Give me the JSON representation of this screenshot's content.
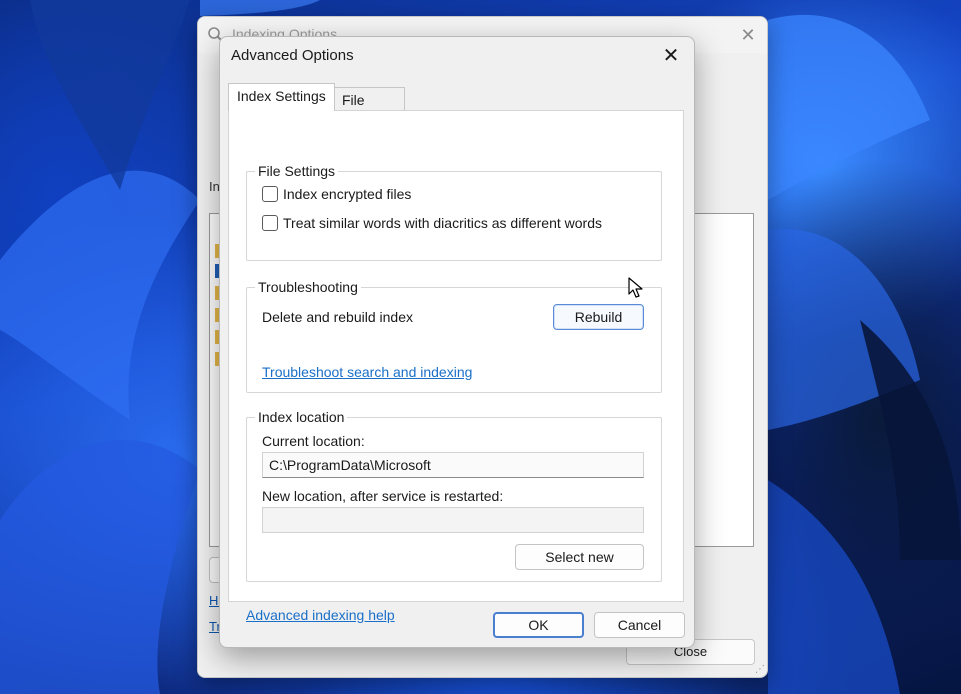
{
  "background_window": {
    "title": "Indexing Options",
    "label_fragment": "In",
    "link1_fragment": "Ho",
    "link2_fragment": "Tr",
    "close_button": "Close",
    "close_icon": "close-icon"
  },
  "dialog": {
    "title": "Advanced Options",
    "close_icon": "close-icon",
    "tabs": [
      {
        "label": "Index Settings",
        "active": true
      },
      {
        "label": "File Types",
        "active": false
      }
    ],
    "file_settings": {
      "title": "File Settings",
      "checkboxes": [
        {
          "label": "Index encrypted files",
          "checked": false
        },
        {
          "label": "Treat similar words with diacritics as different words",
          "checked": false
        }
      ]
    },
    "troubleshooting": {
      "title": "Troubleshooting",
      "description": "Delete and rebuild index",
      "rebuild_button": "Rebuild",
      "link": "Troubleshoot search and indexing"
    },
    "index_location": {
      "title": "Index location",
      "current_label": "Current location:",
      "current_value": "C:\\ProgramData\\Microsoft",
      "new_label": "New location, after service is restarted:",
      "new_value": "",
      "select_button": "Select new"
    },
    "help_link": "Advanced indexing help",
    "ok_button": "OK",
    "cancel_button": "Cancel"
  },
  "colors": {
    "link": "#1a6fc8",
    "dialog_bg": "#f0f0f0",
    "panel_bg": "#ffffff",
    "accent": "#4a7fd0"
  }
}
